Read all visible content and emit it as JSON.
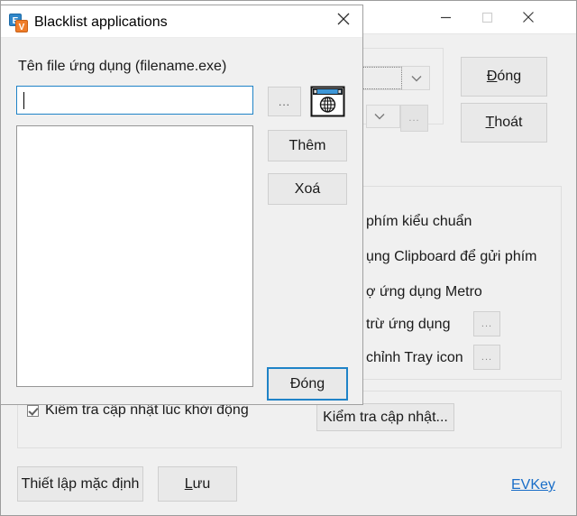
{
  "main_window": {
    "titlebar": {
      "minimize_glyph": "minimize-icon",
      "maximize_glyph": "maximize-icon",
      "close_glyph": "close-icon"
    },
    "top_group": {
      "combo1_value": "",
      "combo2_value": "",
      "dots_label": "...",
      "close_label": "Đóng",
      "close_accel": "Đ",
      "quit_label": "Thoát",
      "quit_accel": "T"
    },
    "options_group": {
      "rows": [
        {
          "label": "phím kiểu chuẩn",
          "has_dots": false,
          "dots_label": ""
        },
        {
          "label": "ụng Clipboard để gửi phím",
          "has_dots": false,
          "dots_label": ""
        },
        {
          "label": "ợ ứng dụng Metro",
          "has_dots": false,
          "dots_label": ""
        },
        {
          "label": "trừ ứng dụng",
          "has_dots": true,
          "dots_label": "..."
        },
        {
          "label": "chỉnh Tray icon",
          "has_dots": true,
          "dots_label": "..."
        }
      ]
    },
    "update_group": {
      "checkbox_label": "Kiểm tra cập nhật lúc khởi động",
      "checkbox_checked": true,
      "button_label": "Kiểm tra cập nhật..."
    },
    "footer": {
      "default_label": "Thiết lập mặc định",
      "save_label": "Lưu",
      "save_accel": "L",
      "save_rest": "ưu",
      "link_label": "EVKey",
      "link_color": "#1a6ec8"
    }
  },
  "dialog": {
    "title": "Blacklist applications",
    "icon_name": "evkey-app-icon",
    "close_glyph": "close-icon",
    "field_label": "Tên file ứng dụng (filename.exe)",
    "input_value": "",
    "input_placeholder": "",
    "input_focus_color": "#1f83c7",
    "browse_label": "...",
    "picker_icon_name": "window-globe-picker-icon",
    "add_label": "Thêm",
    "delete_label": "Xoá",
    "close_label": "Đóng",
    "list_items": []
  }
}
